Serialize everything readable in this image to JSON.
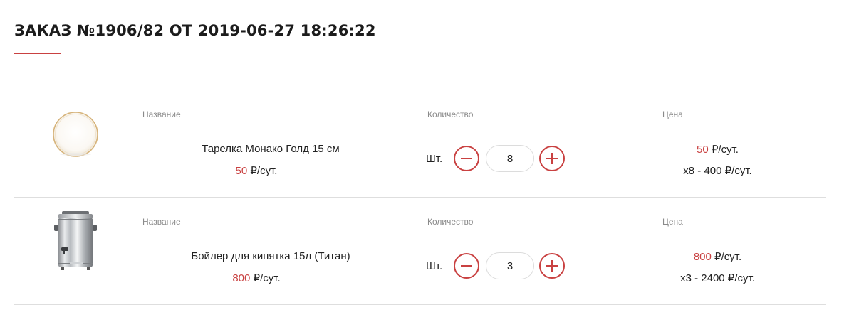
{
  "order": {
    "title": "ЗАКАЗ №1906/82 ОТ 2019-06-27 18:26:22"
  },
  "colors": {
    "accent": "#c94141",
    "divider": "#dedede",
    "label": "#8a8a8a"
  },
  "items": [
    {
      "label_name": "Название",
      "label_qty": "Количество",
      "label_price": "Цена",
      "name": "Тарелка Монако Голд 15 см",
      "price_value": "50",
      "price_unit": "₽/сут.",
      "qty_unit": "Шт.",
      "quantity": "8",
      "unit_price_value": "50",
      "unit_price_unit": "₽/сут.",
      "total": "x8 - 400 ₽/сут.",
      "image_icon": "plate-image"
    },
    {
      "label_name": "Название",
      "label_qty": "Количество",
      "label_price": "Цена",
      "name": "Бойлер для кипятка 15л (Титан)",
      "price_value": "800",
      "price_unit": "₽/сут.",
      "qty_unit": "Шт.",
      "quantity": "3",
      "unit_price_value": "800",
      "unit_price_unit": "₽/сут.",
      "total": "x3 - 2400 ₽/сут.",
      "image_icon": "boiler-image"
    }
  ]
}
